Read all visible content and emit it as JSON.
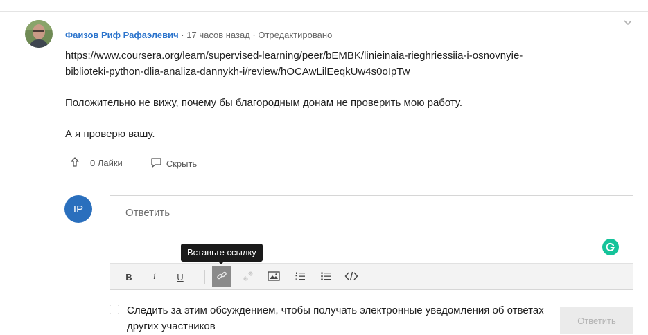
{
  "comment": {
    "author": "Фаизов Риф Рафаэлевич",
    "separator1": " · ",
    "time": "17 часов назад",
    "separator2": " · ",
    "edited": "Отредактировано",
    "link_line1": "https://www.coursera.org/learn/supervised-learning/peer/bEMBK/linieinaia-rieghriessiia-i-osnovnyie-",
    "link_line2": "biblioteki-python-dlia-analiza-dannykh-i/review/hOCAwLilEeqkUw4s0oIpTw",
    "paragraph1": "Положительно не вижу, почему бы благородным донам не проверить мою работу.",
    "paragraph2": "А я проверю вашу.",
    "likes_label": "0 Лайки",
    "hide_label": "Скрыть",
    "chevron_icon": "chevron-down-icon"
  },
  "reply": {
    "avatar_initials": "IP",
    "avatar_color": "#2a6fbd",
    "placeholder": "Ответить",
    "tooltip": "Вставьте ссылку",
    "toolbar": {
      "bold": "B",
      "italic": "i",
      "underline": "U"
    },
    "follow_label": "Следить за этим обсуждением, чтобы получать электронные уведомления об ответах других участников",
    "submit_label": "Ответить"
  },
  "colors": {
    "author_link": "#2a73cc",
    "grammarly": "#15c39a",
    "tooltip_bg": "#1a1a1a",
    "submit_disabled_bg": "#ebebeb"
  }
}
